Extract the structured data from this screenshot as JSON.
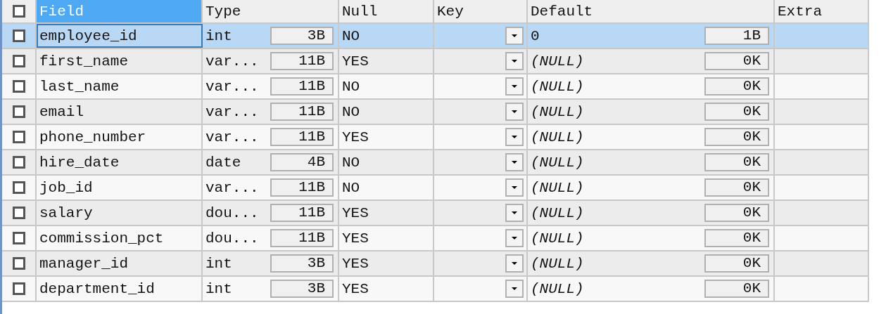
{
  "columns": [
    {
      "label": "Field",
      "selected": true
    },
    {
      "label": "Type",
      "selected": false
    },
    {
      "label": "Null",
      "selected": false
    },
    {
      "label": "Key",
      "selected": false
    },
    {
      "label": "Default",
      "selected": false
    },
    {
      "label": "Extra",
      "selected": false
    }
  ],
  "header_checkbox": {
    "checked": false
  },
  "rows": [
    {
      "checked": false,
      "selected": true,
      "field": "employee_id",
      "type": "int",
      "type_size": "3B",
      "null": "NO",
      "default": "0",
      "default_is_null": false,
      "default_size": "1B"
    },
    {
      "checked": false,
      "selected": false,
      "field": "first_name",
      "type": "var...",
      "type_size": "11B",
      "null": "YES",
      "default": "(NULL)",
      "default_is_null": true,
      "default_size": "0K"
    },
    {
      "checked": false,
      "selected": false,
      "field": "last_name",
      "type": "var...",
      "type_size": "11B",
      "null": "NO",
      "default": "(NULL)",
      "default_is_null": true,
      "default_size": "0K"
    },
    {
      "checked": false,
      "selected": false,
      "field": "email",
      "type": "var...",
      "type_size": "11B",
      "null": "NO",
      "default": "(NULL)",
      "default_is_null": true,
      "default_size": "0K"
    },
    {
      "checked": false,
      "selected": false,
      "field": "phone_number",
      "type": "var...",
      "type_size": "11B",
      "null": "YES",
      "default": "(NULL)",
      "default_is_null": true,
      "default_size": "0K"
    },
    {
      "checked": false,
      "selected": false,
      "field": "hire_date",
      "type": "date",
      "type_size": "4B",
      "null": "NO",
      "default": "(NULL)",
      "default_is_null": true,
      "default_size": "0K"
    },
    {
      "checked": false,
      "selected": false,
      "field": "job_id",
      "type": "var...",
      "type_size": "11B",
      "null": "NO",
      "default": "(NULL)",
      "default_is_null": true,
      "default_size": "0K"
    },
    {
      "checked": false,
      "selected": false,
      "field": "salary",
      "type": "dou...",
      "type_size": "11B",
      "null": "YES",
      "default": "(NULL)",
      "default_is_null": true,
      "default_size": "0K"
    },
    {
      "checked": false,
      "selected": false,
      "field": "commission_pct",
      "type": "dou...",
      "type_size": "11B",
      "null": "YES",
      "default": "(NULL)",
      "default_is_null": true,
      "default_size": "0K"
    },
    {
      "checked": false,
      "selected": false,
      "field": "manager_id",
      "type": "int",
      "type_size": "3B",
      "null": "YES",
      "default": "(NULL)",
      "default_is_null": true,
      "default_size": "0K"
    },
    {
      "checked": false,
      "selected": false,
      "field": "department_id",
      "type": "int",
      "type_size": "3B",
      "null": "YES",
      "default": "(NULL)",
      "default_is_null": true,
      "default_size": "0K"
    }
  ]
}
